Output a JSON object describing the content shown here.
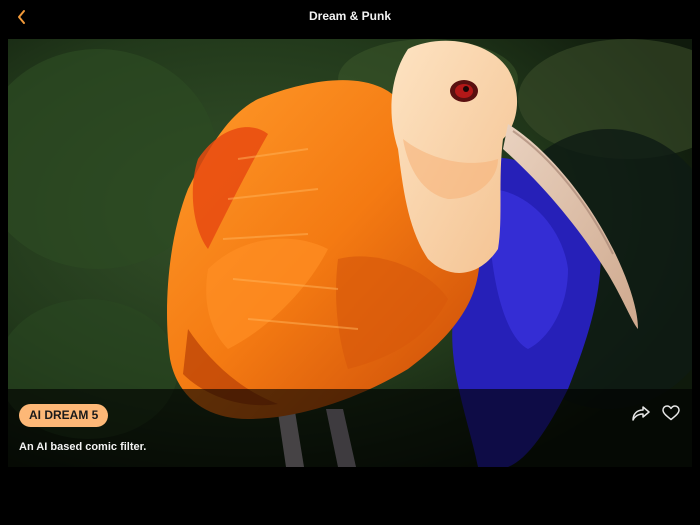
{
  "nav": {
    "title": "Dream & Punk",
    "back_icon": "chevron-left-icon"
  },
  "artwork": {
    "subject": "scarlet-ibis painting"
  },
  "panel": {
    "badge_label": "AI DREAM 5",
    "description": "An AI based comic filter.",
    "share_icon": "share-arrow-icon",
    "like_icon": "heart-outline-icon"
  },
  "colors": {
    "accent": "#f29a3a",
    "badge_bg": "#fdb877",
    "background": "#000000"
  }
}
